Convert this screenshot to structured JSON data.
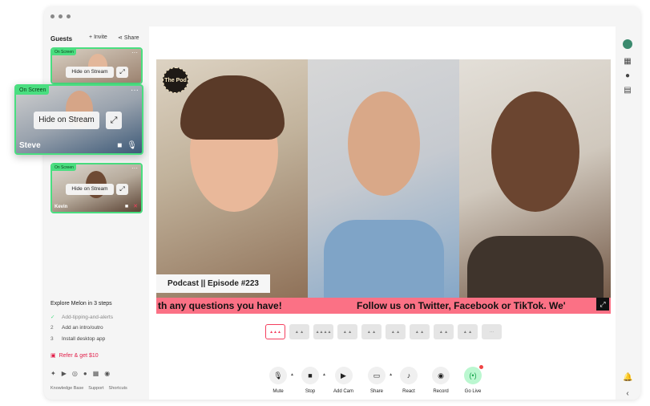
{
  "sidebar": {
    "title": "Guests",
    "invite_label": "Invite",
    "share_label": "Share",
    "guests": [
      {
        "badge": "On Screen",
        "hide_label": "Hide on Stream",
        "name": ""
      },
      {
        "badge": "On Screen",
        "hide_label": "Hide on Stream",
        "name": "Steve"
      },
      {
        "badge": "On Screen",
        "hide_label": "Hide on Stream",
        "name": "Kevin"
      }
    ],
    "explore_title": "Explore Melon in 3 steps",
    "steps": [
      {
        "num": "✓",
        "label": "Add-tipping-and-alerts"
      },
      {
        "num": "2",
        "label": "Add an intro/outro"
      },
      {
        "num": "3",
        "label": "Install desktop app"
      }
    ],
    "refer_label": "Refer & get $10",
    "footer": [
      "Knowledge Base",
      "Support",
      "Shortcuts"
    ]
  },
  "stage": {
    "logo_text": "The Pod",
    "lower_third": "Podcast || Episode #223",
    "ticker_left": "th any questions you have!",
    "ticker_right": "Follow us on Twitter, Facebook or TikTok. We'",
    "layout_count": 10,
    "controls": [
      {
        "label": "Mute",
        "icon": "microphone-icon",
        "glyph": "🎙",
        "caret": true
      },
      {
        "label": "Stop",
        "icon": "camera-icon",
        "glyph": "■",
        "caret": true
      },
      {
        "label": "Add Cam",
        "icon": "add-camera-icon",
        "glyph": "▶",
        "caret": false
      },
      {
        "label": "Share",
        "icon": "screen-share-icon",
        "glyph": "▭",
        "caret": true
      },
      {
        "label": "React",
        "icon": "music-note-icon",
        "glyph": "♪",
        "caret": false
      },
      {
        "label": "Record",
        "icon": "record-icon",
        "glyph": "◉",
        "caret": false
      },
      {
        "label": "Go Live",
        "icon": "broadcast-icon",
        "glyph": "((•))",
        "caret": false
      }
    ]
  },
  "colors": {
    "accent_green": "#4ade80",
    "ticker_pink": "#fb7185",
    "refer_red": "#e11d48"
  }
}
